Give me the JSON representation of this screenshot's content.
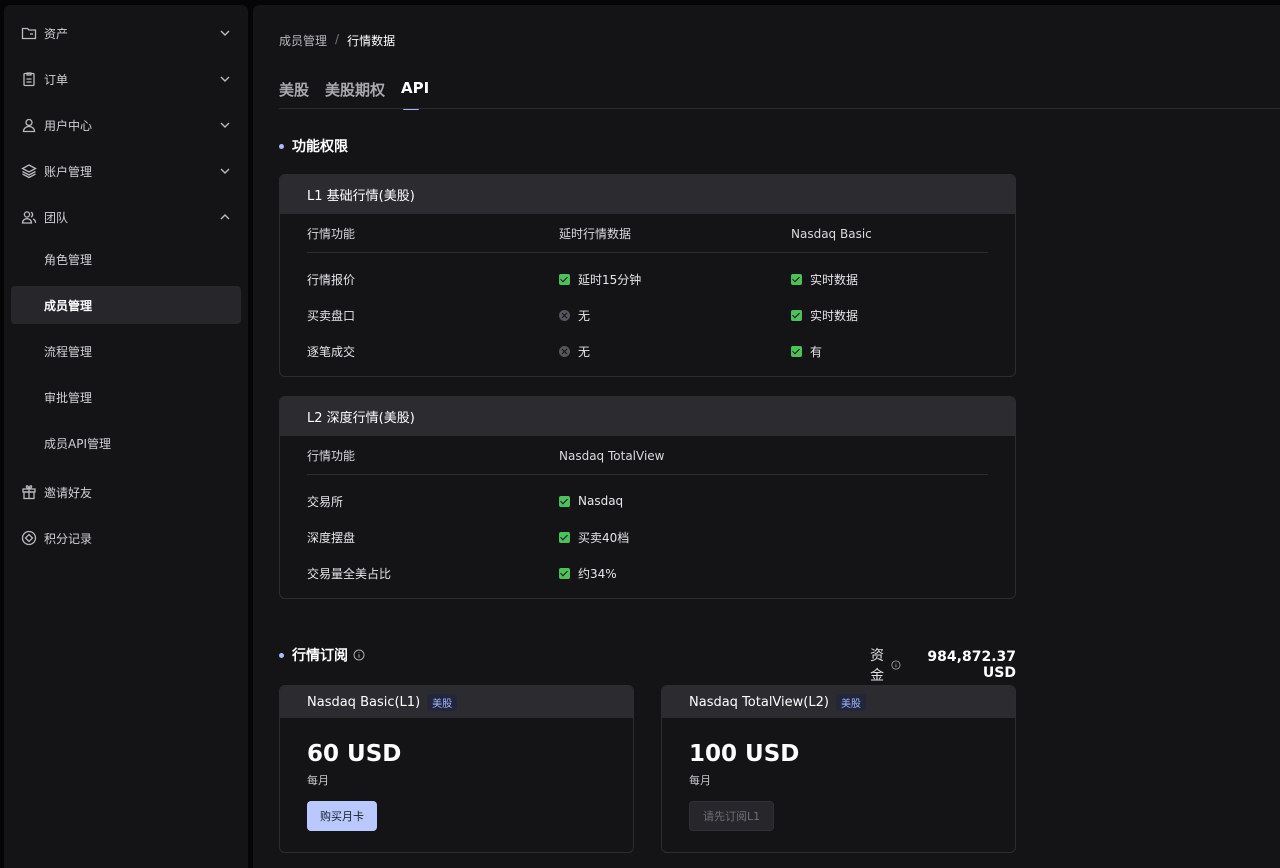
{
  "sidebar": {
    "items": [
      {
        "label": "资产"
      },
      {
        "label": "订单"
      },
      {
        "label": "用户中心"
      },
      {
        "label": "账户管理"
      },
      {
        "label": "团队"
      },
      {
        "label": "角色管理"
      },
      {
        "label": "成员管理"
      },
      {
        "label": "流程管理"
      },
      {
        "label": "审批管理"
      },
      {
        "label": "成员API管理"
      },
      {
        "label": "邀请好友"
      },
      {
        "label": "积分记录"
      }
    ]
  },
  "breadcrumb": {
    "parent": "成员管理",
    "separator": "/",
    "current": "行情数据"
  },
  "tabs": [
    {
      "label": "美股",
      "active": false
    },
    {
      "label": "美股期权",
      "active": false
    },
    {
      "label": "API",
      "active": true
    }
  ],
  "permissions": {
    "title": "功能权限",
    "l1": {
      "title": "L1 基础行情(美股)",
      "headers": [
        "行情功能",
        "延时行情数据",
        "Nasdaq Basic"
      ],
      "rows": [
        {
          "feature": "行情报价",
          "delayed": "延时15分钟",
          "delayed_ok": true,
          "basic": "实时数据",
          "basic_ok": true
        },
        {
          "feature": "买卖盘口",
          "delayed": "无",
          "delayed_ok": false,
          "basic": "实时数据",
          "basic_ok": true
        },
        {
          "feature": "逐笔成交",
          "delayed": "无",
          "delayed_ok": false,
          "basic": "有",
          "basic_ok": true
        }
      ]
    },
    "l2": {
      "title": "L2 深度行情(美股)",
      "headers": [
        "行情功能",
        "Nasdaq TotalView"
      ],
      "rows": [
        {
          "feature": "交易所",
          "value": "Nasdaq"
        },
        {
          "feature": "深度摆盘",
          "value": "买卖40档"
        },
        {
          "feature": "交易量全美占比",
          "value": "约34%"
        }
      ]
    }
  },
  "subscription": {
    "title": "行情订阅",
    "funds_label": "资金",
    "funds_value": "984,872.37 USD",
    "cards": [
      {
        "name": "Nasdaq Basic(L1)",
        "tag": "美股",
        "price": "60 USD",
        "period": "每月",
        "button": "购买月卡"
      },
      {
        "name": "Nasdaq TotalView(L2)",
        "tag": "美股",
        "price": "100 USD",
        "period": "每月",
        "button": "请先订阅L1"
      }
    ]
  },
  "colors": {
    "accent": "#9fb6ff",
    "check": "#4cc15a",
    "primary_button": "#b9c9ff"
  }
}
